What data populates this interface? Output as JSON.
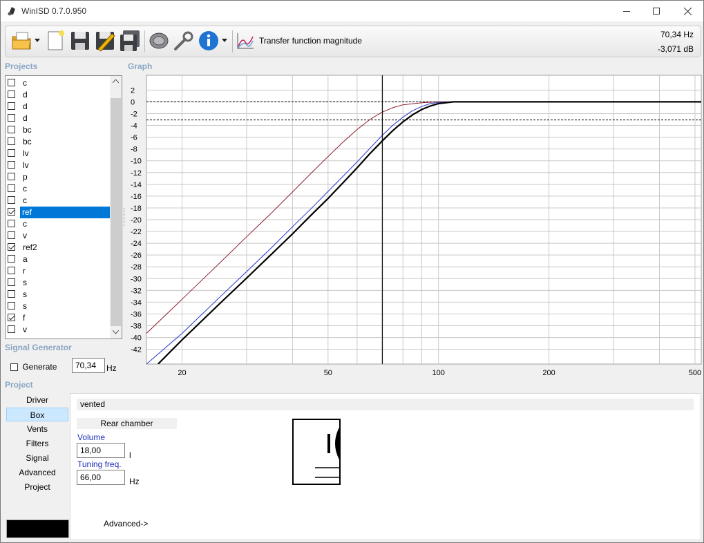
{
  "window": {
    "title": "WinISD 0.7.0.950"
  },
  "toolbar": {
    "icons": [
      "open-folder-icon",
      "dropdown-arrow-icon",
      "new-project-icon",
      "save-icon",
      "edit-save-icon",
      "save-all-icon",
      "driver-icon",
      "tools-icon",
      "info-icon",
      "dropdown-arrow-icon",
      "graph-icon"
    ],
    "graph_name": "Transfer function magnitude",
    "readout_freq": "70,34 Hz",
    "readout_db": "-3,071 dB"
  },
  "sections": {
    "projects": "Projects",
    "graph": "Graph",
    "signal_generator": "Signal Generator",
    "project": "Project"
  },
  "projects": [
    {
      "name": "c",
      "checked": false,
      "selected": false
    },
    {
      "name": "d",
      "checked": false,
      "selected": false
    },
    {
      "name": "d",
      "checked": false,
      "selected": false
    },
    {
      "name": "d",
      "checked": false,
      "selected": false
    },
    {
      "name": "bc",
      "checked": false,
      "selected": false
    },
    {
      "name": "bc",
      "checked": false,
      "selected": false
    },
    {
      "name": "lv",
      "checked": false,
      "selected": false
    },
    {
      "name": "lv",
      "checked": false,
      "selected": false
    },
    {
      "name": "p",
      "checked": false,
      "selected": false
    },
    {
      "name": "c",
      "checked": false,
      "selected": false
    },
    {
      "name": "c",
      "checked": false,
      "selected": false
    },
    {
      "name": "ref",
      "checked": true,
      "selected": true
    },
    {
      "name": "c",
      "checked": false,
      "selected": false
    },
    {
      "name": "v",
      "checked": false,
      "selected": false
    },
    {
      "name": "ref2",
      "checked": true,
      "selected": false
    },
    {
      "name": "a",
      "checked": false,
      "selected": false
    },
    {
      "name": "r",
      "checked": false,
      "selected": false
    },
    {
      "name": "s",
      "checked": false,
      "selected": false
    },
    {
      "name": "s",
      "checked": false,
      "selected": false
    },
    {
      "name": "s",
      "checked": false,
      "selected": false
    },
    {
      "name": "f",
      "checked": true,
      "selected": false
    },
    {
      "name": "v",
      "checked": false,
      "selected": false
    }
  ],
  "signal_generator": {
    "generate_label": "Generate",
    "generate_checked": false,
    "frequency": "70,34",
    "unit": "Hz"
  },
  "project_nav": [
    {
      "label": "Driver",
      "active": false
    },
    {
      "label": "Box",
      "active": true
    },
    {
      "label": "Vents",
      "active": false
    },
    {
      "label": "Filters",
      "active": false
    },
    {
      "label": "Signal",
      "active": false
    },
    {
      "label": "Advanced",
      "active": false
    },
    {
      "label": "Project",
      "active": false
    }
  ],
  "box_panel": {
    "box_type": "vented",
    "chamber_header": "Rear chamber",
    "volume_label": "Volume",
    "volume_value": "18,00",
    "volume_unit": "l",
    "tuning_label": "Tuning freq.",
    "tuning_value": "66,00",
    "tuning_unit": "Hz",
    "advanced_link": "Advanced->"
  },
  "chart_data": {
    "type": "line",
    "title": "Transfer function magnitude",
    "xscale": "log",
    "xlim": [
      16,
      520
    ],
    "ylim": [
      -44.5,
      4.5
    ],
    "xticks": [
      20,
      50,
      100,
      200,
      500
    ],
    "yticks": [
      2,
      0,
      -2,
      -4,
      -6,
      -8,
      -10,
      -12,
      -14,
      -16,
      -18,
      -20,
      -22,
      -24,
      -26,
      -28,
      -30,
      -32,
      -34,
      -36,
      -38,
      -40,
      -42
    ],
    "grid": true,
    "cursor": {
      "x": 70.34,
      "y": -3.071
    },
    "reference_lines_y": [
      0,
      -3.071
    ],
    "series": [
      {
        "color": "#8b1a2b",
        "width": 1,
        "points": [
          [
            16,
            -39.3
          ],
          [
            20,
            -33.5
          ],
          [
            25,
            -27.7
          ],
          [
            30,
            -22.9
          ],
          [
            35,
            -18.9
          ],
          [
            40,
            -15.3
          ],
          [
            45,
            -12.1
          ],
          [
            50,
            -9.3
          ],
          [
            55,
            -6.8
          ],
          [
            60,
            -4.7
          ],
          [
            65,
            -3.0
          ],
          [
            70,
            -1.8
          ],
          [
            75,
            -1.0
          ],
          [
            80,
            -0.5
          ],
          [
            90,
            -0.15
          ],
          [
            100,
            0
          ],
          [
            520,
            0
          ]
        ]
      },
      {
        "color": "#2233cc",
        "width": 1,
        "points": [
          [
            16,
            -44.5
          ],
          [
            20,
            -39.3
          ],
          [
            25,
            -33.5
          ],
          [
            30,
            -28.8
          ],
          [
            35,
            -24.8
          ],
          [
            40,
            -21.2
          ],
          [
            45,
            -18.1
          ],
          [
            50,
            -15.2
          ],
          [
            55,
            -12.6
          ],
          [
            60,
            -10.2
          ],
          [
            65,
            -7.9
          ],
          [
            70,
            -5.8
          ],
          [
            75,
            -4.0
          ],
          [
            80,
            -2.6
          ],
          [
            85,
            -1.5
          ],
          [
            90,
            -0.8
          ],
          [
            95,
            -0.3
          ],
          [
            100,
            -0.1
          ],
          [
            110,
            0
          ],
          [
            520,
            0
          ]
        ]
      },
      {
        "color": "#000000",
        "width": 2.2,
        "points": [
          [
            17.2,
            -44.5
          ],
          [
            20,
            -40.4
          ],
          [
            25,
            -34.6
          ],
          [
            30,
            -29.9
          ],
          [
            35,
            -25.9
          ],
          [
            40,
            -22.4
          ],
          [
            45,
            -19.2
          ],
          [
            50,
            -16.4
          ],
          [
            55,
            -13.7
          ],
          [
            60,
            -11.2
          ],
          [
            65,
            -8.8
          ],
          [
            70.34,
            -6.6
          ],
          [
            75,
            -4.9
          ],
          [
            80,
            -3.4
          ],
          [
            85,
            -2.2
          ],
          [
            90,
            -1.3
          ],
          [
            95,
            -0.7
          ],
          [
            100,
            -0.3
          ],
          [
            110,
            0
          ],
          [
            520,
            0
          ]
        ]
      }
    ]
  }
}
